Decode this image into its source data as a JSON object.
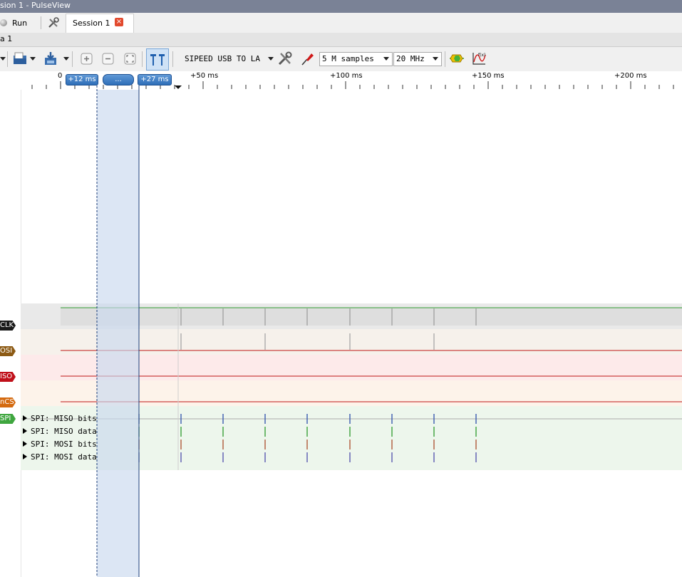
{
  "window": {
    "title": "sion 1 - PulseView"
  },
  "tabs": {
    "run_label": "Run",
    "session_label": "Session 1",
    "close_glyph": "×"
  },
  "dock": {
    "title": "a 1"
  },
  "toolbar": {
    "device": "SIPEED USB TO LA",
    "samples": "5 M samples",
    "rate": "20 MHz",
    "icons": [
      "open-icon",
      "save-icon",
      "zoom-in-icon",
      "zoom-out-icon",
      "zoom-fit-icon",
      "cursor-icon",
      "configure-icon",
      "probe-icon",
      "decoder-icon",
      "math-icon"
    ]
  },
  "ruler": {
    "labels": [
      "0",
      "+50 ms",
      "+100 ms",
      "+150 ms",
      "+200 ms"
    ],
    "flag_left": "+12 ms",
    "flag_mid": "...",
    "flag_right": "+27 ms"
  },
  "channels": [
    {
      "name": "CLK",
      "color": "#1a1a1a"
    },
    {
      "name": "OSI",
      "color": "#8c5a14"
    },
    {
      "name": "ISO",
      "color": "#c0101a"
    },
    {
      "name": "nCS",
      "color": "#d46a10"
    },
    {
      "name": "SPI",
      "color": "#3fa63f"
    }
  ],
  "decoder_rows": [
    "SPI: MISO bits",
    "SPI: MISO data",
    "SPI: MOSI bits",
    "SPI: MOSI data"
  ],
  "colors": {
    "titlebar": "#7a8296",
    "selection": "#c9d9ee",
    "accent": "#2f6fb8"
  }
}
